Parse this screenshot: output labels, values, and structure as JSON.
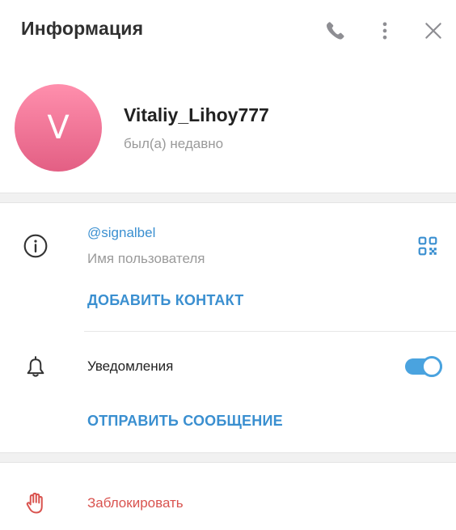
{
  "header": {
    "title": "Информация",
    "icons": {
      "call": "phone-icon",
      "more": "more-vertical-icon",
      "close": "close-icon"
    }
  },
  "profile": {
    "avatar_letter": "V",
    "avatar_colors": [
      "#ff8fad",
      "#e35f84"
    ],
    "name": "Vitaliy_Lihoy777",
    "status": "был(а) недавно"
  },
  "info": {
    "icon": "info-icon",
    "username": "@signalbel",
    "username_label": "Имя пользователя",
    "qr_icon": "qr-code-icon",
    "add_contact": "ДОБАВИТЬ КОНТАКТ"
  },
  "notifications": {
    "icon": "bell-icon",
    "label": "Уведомления",
    "enabled": true,
    "send_message": "ОТПРАВИТЬ СООБЩЕНИЕ"
  },
  "block": {
    "icon": "hand-stop-icon",
    "label": "Заблокировать"
  },
  "colors": {
    "accent": "#3a8fd0",
    "toggle": "#4aa3df",
    "danger": "#d9534f"
  }
}
